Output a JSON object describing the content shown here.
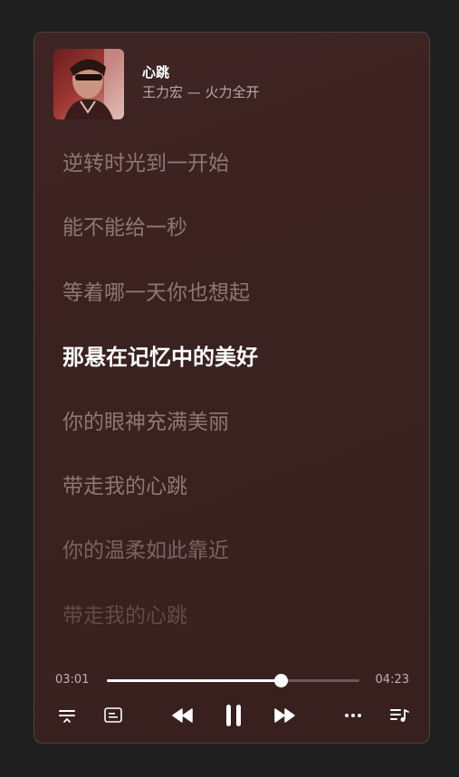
{
  "track": {
    "title": "心跳",
    "subtitle": "王力宏 — 火力全开"
  },
  "lyrics": [
    {
      "text": "逆转时光到一开始",
      "state": "past"
    },
    {
      "text": "能不能给一秒",
      "state": "past"
    },
    {
      "text": "等着哪一天你也想起",
      "state": "past"
    },
    {
      "text": "那悬在记忆中的美好",
      "state": "active"
    },
    {
      "text": "你的眼神充满美丽",
      "state": "next"
    },
    {
      "text": "带走我的心跳",
      "state": "next"
    },
    {
      "text": "你的温柔如此靠近",
      "state": "later"
    },
    {
      "text": "带走我的心跳",
      "state": "faded"
    }
  ],
  "playback": {
    "current_time": "03:01",
    "duration": "04:23",
    "progress_fraction": 0.688,
    "state": "playing"
  },
  "controls": {
    "left": [
      "playback-mode-icon",
      "lyrics-panel-icon"
    ],
    "center": [
      "previous-icon",
      "pause-icon",
      "next-icon"
    ],
    "right": [
      "more-icon",
      "playlist-icon"
    ]
  },
  "colors": {
    "background": "#1f1f1f",
    "panel": "#3a2220",
    "active_lyric": "#ffffff",
    "inactive_lyric": "#8e7775"
  }
}
